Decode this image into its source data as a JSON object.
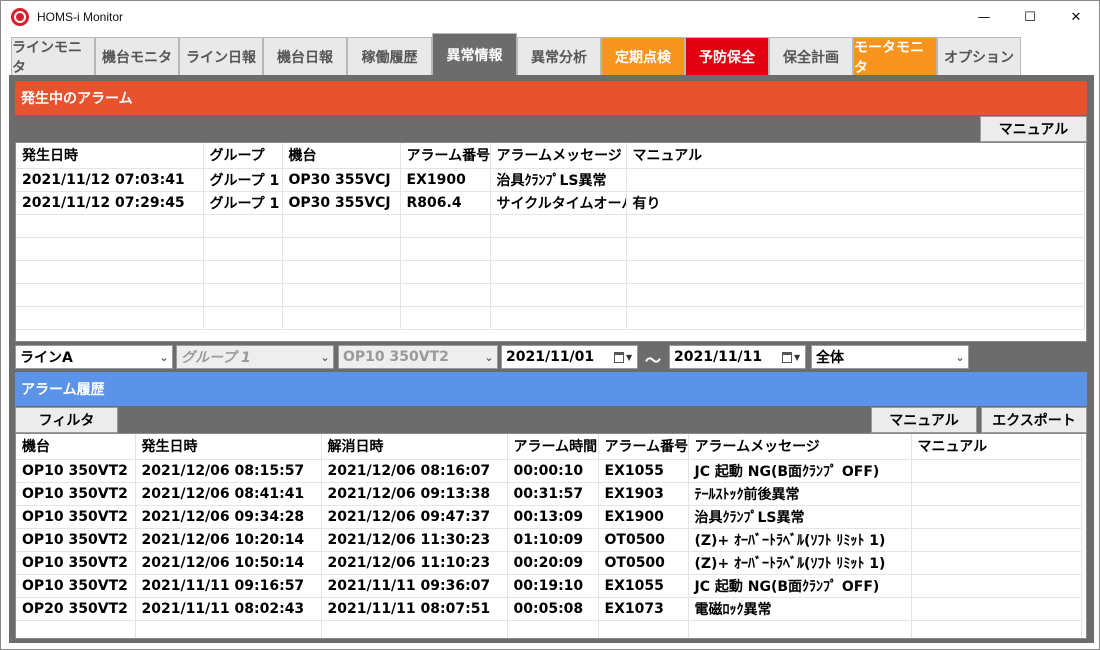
{
  "window": {
    "title": "HOMS-i Monitor",
    "minimize": "—",
    "maximize": "☐",
    "close": "✕"
  },
  "tabs": [
    {
      "label": "ラインモニタ",
      "state": "normal"
    },
    {
      "label": "機台モニタ",
      "state": "normal"
    },
    {
      "label": "ライン日報",
      "state": "normal"
    },
    {
      "label": "機台日報",
      "state": "normal"
    },
    {
      "label": "稼働履歴",
      "state": "normal"
    },
    {
      "label": "異常情報",
      "state": "active"
    },
    {
      "label": "異常分析",
      "state": "normal"
    },
    {
      "label": "定期点検",
      "state": "orange"
    },
    {
      "label": "予防保全",
      "state": "red"
    },
    {
      "label": "保全計画",
      "state": "normal"
    },
    {
      "label": "モータモニタ",
      "state": "orange"
    },
    {
      "label": "オプション",
      "state": "normal"
    }
  ],
  "active_alarms": {
    "title": "発生中のアラーム",
    "manual_button": "マニュアル",
    "columns": [
      "発生日時",
      "グループ",
      "機台",
      "アラーム番号",
      "アラームメッセージ",
      "マニュアル"
    ],
    "rows": [
      [
        "2021/11/12 07:03:41",
        "グループ 1",
        "OP30 355VCJ",
        "EX1900",
        " 治具ｸﾗﾝﾌﾟLS異常",
        ""
      ],
      [
        "2021/11/12 07:29:45",
        "グループ 1",
        "OP30 355VCJ",
        "R806.4",
        "サイクルタイムオーバ",
        "有り"
      ]
    ]
  },
  "filters": {
    "line": "ラインA",
    "group": "グループ 1",
    "machine": "OP10 350VT2",
    "date_from": "2021/11/01",
    "tilde": "～",
    "date_to": "2021/11/11",
    "scope": "全体"
  },
  "alarm_history": {
    "title": "アラーム履歴",
    "filter_button": "フィルタ",
    "manual_button": "マニュアル",
    "export_button": "エクスポート",
    "columns": [
      "機台",
      "発生日時",
      "解消日時",
      "アラーム時間",
      "アラーム番号",
      "アラームメッセージ",
      "マニュアル"
    ],
    "rows": [
      [
        "OP10 350VT2",
        "2021/12/06 08:15:57",
        "2021/12/06 08:16:07",
        "00:00:10",
        "EX1055",
        "JC 起動 NG(B面ｸﾗﾝﾌﾟ OFF)",
        ""
      ],
      [
        "OP10 350VT2",
        "2021/12/06 08:41:41",
        "2021/12/06 09:13:38",
        "00:31:57",
        "EX1903",
        "ﾃｰﾙｽﾄｯｸ前後異常",
        ""
      ],
      [
        "OP10 350VT2",
        "2021/12/06 09:34:28",
        "2021/12/06 09:47:37",
        "00:13:09",
        "EX1900",
        "治具ｸﾗﾝﾌﾟLS異常",
        ""
      ],
      [
        "OP10 350VT2",
        "2021/12/06 10:20:14",
        "2021/12/06 11:30:23",
        "01:10:09",
        "OT0500",
        "(Z)+ ｵｰﾊﾞｰﾄﾗﾍﾞﾙ(ｿﾌﾄ ﾘﾐｯﾄ 1)",
        ""
      ],
      [
        "OP10 350VT2",
        "2021/12/06 10:50:14",
        "2021/12/06 11:10:23",
        "00:20:09",
        "OT0500",
        "(Z)+ ｵｰﾊﾞｰﾄﾗﾍﾞﾙ(ｿﾌﾄ ﾘﾐｯﾄ 1)",
        ""
      ],
      [
        "OP10 350VT2",
        "2021/11/11 09:16:57",
        "2021/11/11 09:36:07",
        "00:19:10",
        "EX1055",
        "JC 起動 NG(B面ｸﾗﾝﾌﾟ OFF)",
        ""
      ],
      [
        "OP20 350VT2",
        "2021/11/11 08:02:43",
        "2021/11/11 08:07:51",
        "00:05:08",
        "EX1073",
        "電磁ﾛｯｸ異常",
        ""
      ]
    ]
  },
  "colors": {
    "active_header": "#e8532f",
    "history_header": "#5b93e8",
    "panel_gray": "#6c6c6c",
    "tab_orange": "#f7941d",
    "tab_red": "#e00012"
  }
}
